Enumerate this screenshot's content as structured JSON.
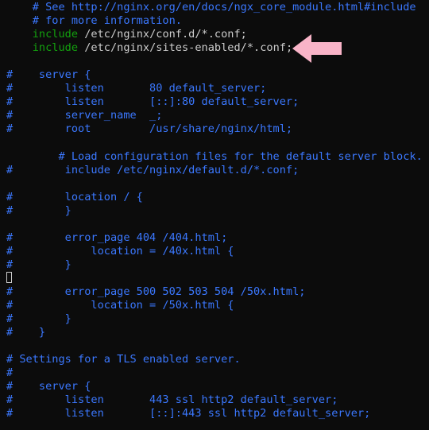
{
  "editor": {
    "top_lines": [
      "    # See http://nginx.org/en/docs/ngx_core_module.html#include",
      "    # for more information."
    ],
    "include_lines": [
      {
        "indent": "    ",
        "keyword": "include",
        "path": " /etc/nginx/conf.d/*.conf;"
      },
      {
        "indent": "    ",
        "keyword": "include",
        "path": " /etc/nginx/sites-enabled/*.conf;"
      }
    ],
    "body_lines": [
      "",
      "#    server {",
      "#        listen       80 default_server;",
      "#        listen       [::]:80 default_server;",
      "#        server_name  _;",
      "#        root         /usr/share/nginx/html;",
      "",
      "        # Load configuration files for the default server block.",
      "#        include /etc/nginx/default.d/*.conf;",
      "",
      "#        location / {",
      "#        }",
      "",
      "#        error_page 404 /404.html;",
      "#            location = /40x.html {",
      "#        }",
      "",
      "#        error_page 500 502 503 504 /50x.html;",
      "#            location = /50x.html {",
      "#        }",
      "#    }",
      "",
      "# Settings for a TLS enabled server.",
      "#",
      "#    server {",
      "#        listen       443 ssl http2 default_server;",
      "#        listen       [::]:443 ssl http2 default_server;"
    ]
  },
  "annotation": {
    "icon": "pink-left-arrow-icon",
    "color": "#f9b4c8"
  },
  "colors": {
    "background": "#0c0c0c",
    "comment": "#3b78ff",
    "keyword": "#13a10e",
    "text": "#cccccc"
  }
}
